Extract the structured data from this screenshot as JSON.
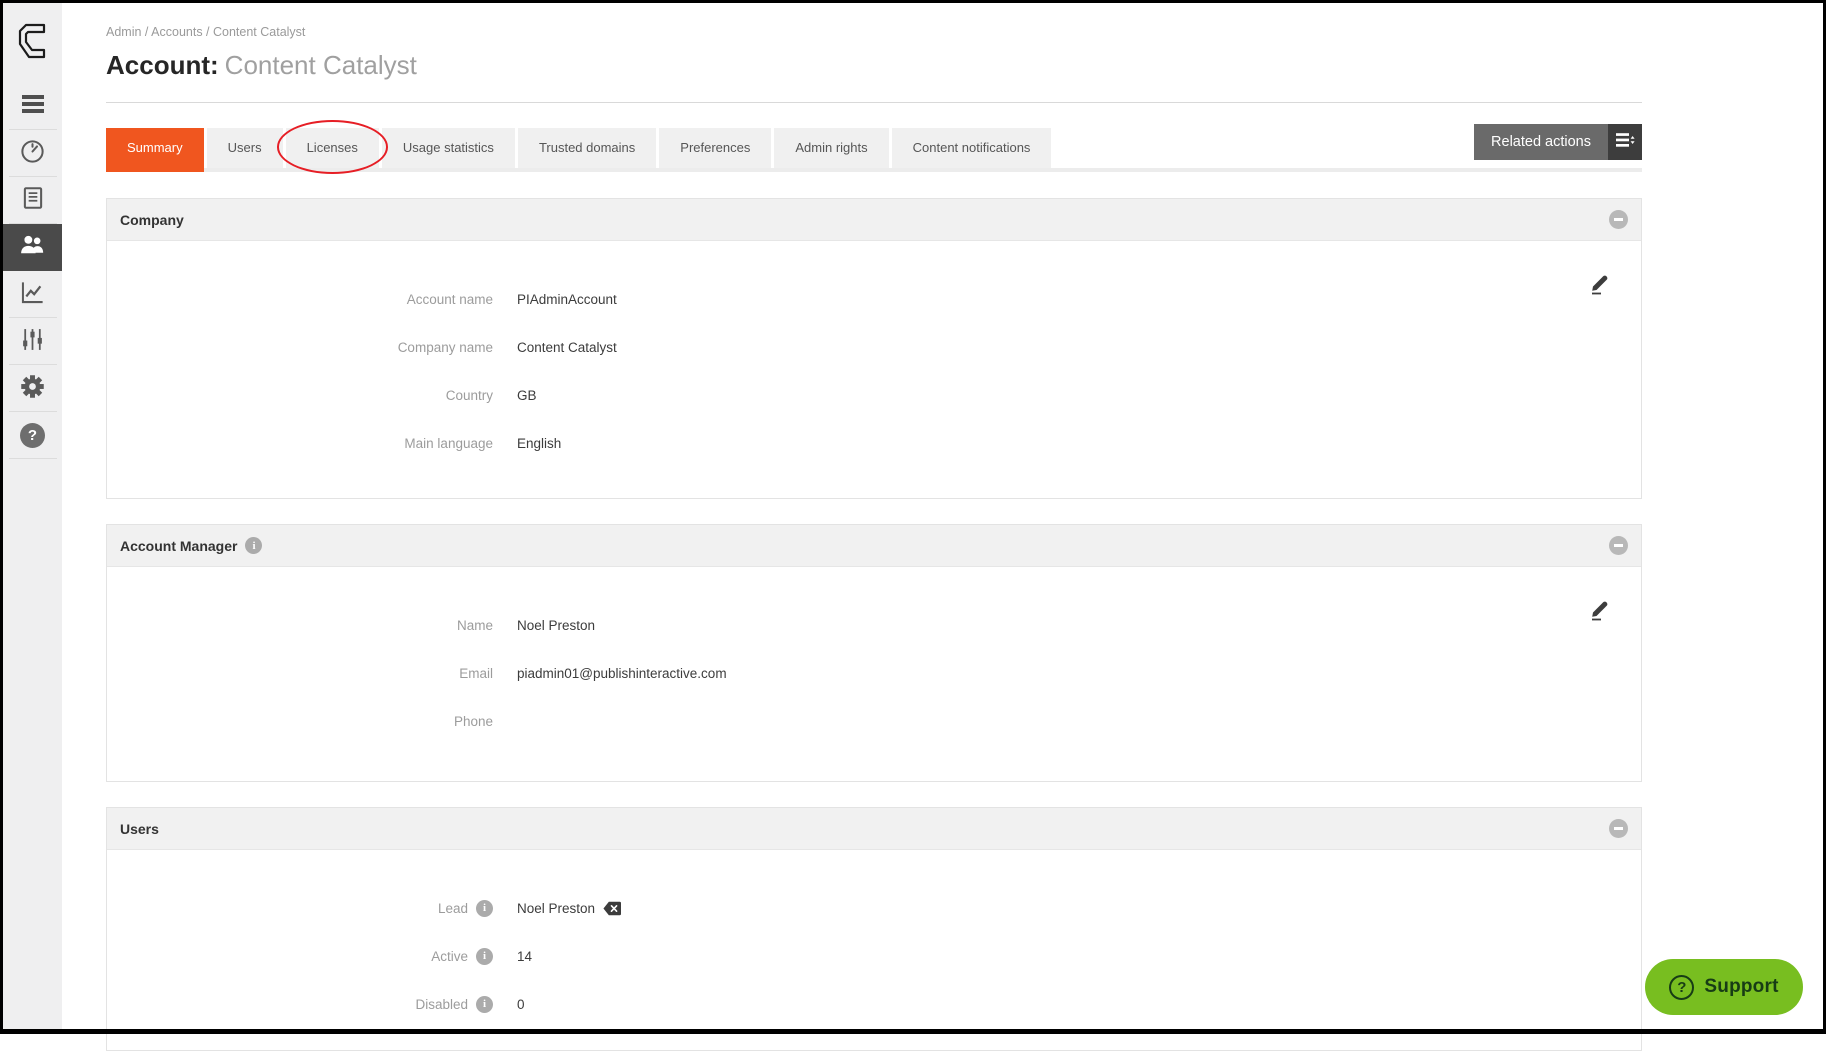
{
  "header": {
    "breadcrumb": "Admin / Accounts / Content Catalyst",
    "title_label": "Account:",
    "title_value": "Content Catalyst"
  },
  "tabs": [
    {
      "label": "Summary",
      "active": true
    },
    {
      "label": "Users"
    },
    {
      "label": "Licenses",
      "annotated": true
    },
    {
      "label": "Usage statistics"
    },
    {
      "label": "Trusted domains"
    },
    {
      "label": "Preferences"
    },
    {
      "label": "Admin rights"
    },
    {
      "label": "Content notifications"
    }
  ],
  "related_actions": {
    "label": "Related actions"
  },
  "sections": {
    "company": {
      "title": "Company",
      "fields": [
        {
          "label": "Account name",
          "value": "PIAdminAccount"
        },
        {
          "label": "Company name",
          "value": "Content Catalyst"
        },
        {
          "label": "Country",
          "value": "GB"
        },
        {
          "label": "Main language",
          "value": "English"
        }
      ]
    },
    "account_manager": {
      "title": "Account Manager",
      "fields": [
        {
          "label": "Name",
          "value": "Noel Preston"
        },
        {
          "label": "Email",
          "value": "piadmin01@publishinteractive.com"
        },
        {
          "label": "Phone",
          "value": ""
        }
      ]
    },
    "users": {
      "title": "Users",
      "fields": [
        {
          "label": "Lead",
          "value": "Noel Preston"
        },
        {
          "label": "Active",
          "value": "14"
        },
        {
          "label": "Disabled",
          "value": "0"
        }
      ]
    }
  },
  "support": {
    "label": "Support"
  },
  "icons": {
    "info_glyph": "i",
    "help_glyph": "?",
    "support_glyph": "?"
  },
  "sidebar": {
    "items": [
      "menu",
      "dashboard",
      "reports",
      "accounts",
      "analytics",
      "preferences",
      "settings",
      "help"
    ],
    "active": "accounts"
  },
  "colors": {
    "accent_orange": "#f0561f",
    "annotation_red": "#e61e25",
    "support_green": "#78be20",
    "sidebar_active": "#4a4a4a",
    "related_actions_gray": "#6a6a6a"
  }
}
